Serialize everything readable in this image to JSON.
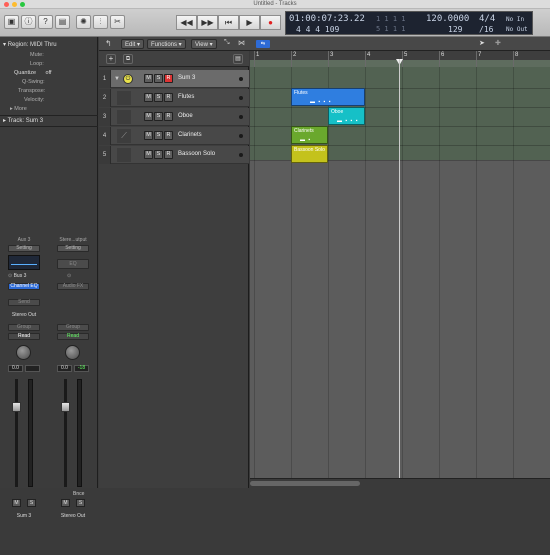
{
  "window": {
    "title": "Untitled - Tracks",
    "traffic_lights": [
      "#ff5f57",
      "#febc2e",
      "#28c840"
    ]
  },
  "control_bar": {
    "left_icons": [
      "library-icon",
      "inspector-icon",
      "help-icon",
      "toolbar-icon"
    ],
    "tool_icons": [
      "smart-controls-icon",
      "mixer-icon",
      "editors-icon"
    ],
    "transport": {
      "rewind": "◀◀",
      "forward": "▶▶",
      "to_start": "⏮",
      "play": "▶",
      "record": "●"
    },
    "lcd": {
      "time": "01:00:07:23.22",
      "time_extra": "1  1  1  1",
      "bars": "4  4  4  109",
      "bars_extra": "5  1  1  1",
      "tempo": "120.0000",
      "tempo_extra": "129",
      "signature": "4/4",
      "division": "/16",
      "in": "No In",
      "out": "No Out"
    }
  },
  "inspector": {
    "region_header": "Region: MIDI Thru",
    "rows": [
      {
        "label": "Mute:",
        "value": ""
      },
      {
        "label": "Loop:",
        "value": ""
      },
      {
        "label": "Quantize",
        "value": "off"
      },
      {
        "label": "Q-Swing:",
        "value": ""
      },
      {
        "label": "Transpose:",
        "value": ""
      },
      {
        "label": "Velocity:",
        "value": ""
      }
    ],
    "more_label": "More",
    "track_header": "Track:  Sum 3",
    "strips": [
      {
        "top_label": "Aux 3",
        "setting": "Setting",
        "eq_label": "",
        "input": "Bus 3",
        "plugin": "Channel EQ",
        "send": "Send",
        "output": "Stereo Out",
        "group": "Group",
        "automation": "Read",
        "volume": "0.0",
        "pan_value": "",
        "bottom_name": "Sum 3",
        "mute": "M",
        "solo": "S"
      },
      {
        "top_label": "Stere...utput",
        "setting": "Setting",
        "eq_label": "EQ",
        "input": "",
        "plugin": "Audio FX",
        "send": "",
        "output": "",
        "group": "Group",
        "automation": "Read",
        "volume": "0.0",
        "pan_value": "-18",
        "bottom_name": "Stereo Out",
        "bnce": "Bnce",
        "mute": "M",
        "solo": "S"
      }
    ]
  },
  "tracks_toolbar": {
    "edit": "Edit",
    "functions": "Functions",
    "view": "View"
  },
  "ruler": {
    "bars": [
      "1",
      "2",
      "3",
      "4",
      "5",
      "6",
      "7",
      "8"
    ]
  },
  "tracks": [
    {
      "num": "1",
      "name": "Sum 3",
      "selected": true,
      "record": true,
      "mute": "M",
      "solo": "S",
      "rec": "R"
    },
    {
      "num": "2",
      "name": "Flutes",
      "selected": false,
      "record": false,
      "mute": "M",
      "solo": "S",
      "rec": "R"
    },
    {
      "num": "3",
      "name": "Oboe",
      "selected": false,
      "record": false,
      "mute": "M",
      "solo": "S",
      "rec": "R"
    },
    {
      "num": "4",
      "name": "Clarinets",
      "selected": false,
      "record": false,
      "mute": "M",
      "solo": "S",
      "rec": "R"
    },
    {
      "num": "5",
      "name": "Bassoon Solo",
      "selected": false,
      "record": false,
      "mute": "M",
      "solo": "S",
      "rec": "R"
    }
  ],
  "regions": [
    {
      "name": "Flutes",
      "color": "#2f7ee0",
      "track": 2,
      "bar_start": 2.0,
      "bar_end": 4.0
    },
    {
      "name": "Oboe",
      "color": "#16c0c7",
      "track": 3,
      "bar_start": 3.0,
      "bar_end": 4.0
    },
    {
      "name": "Clarinets",
      "color": "#6aa82d",
      "track": 4,
      "bar_start": 2.0,
      "bar_end": 3.0
    },
    {
      "name": "Bassoon Solo",
      "color": "#c4c21c",
      "track": 5,
      "bar_start": 2.0,
      "bar_end": 3.0
    }
  ],
  "playhead_bar": 5.0
}
